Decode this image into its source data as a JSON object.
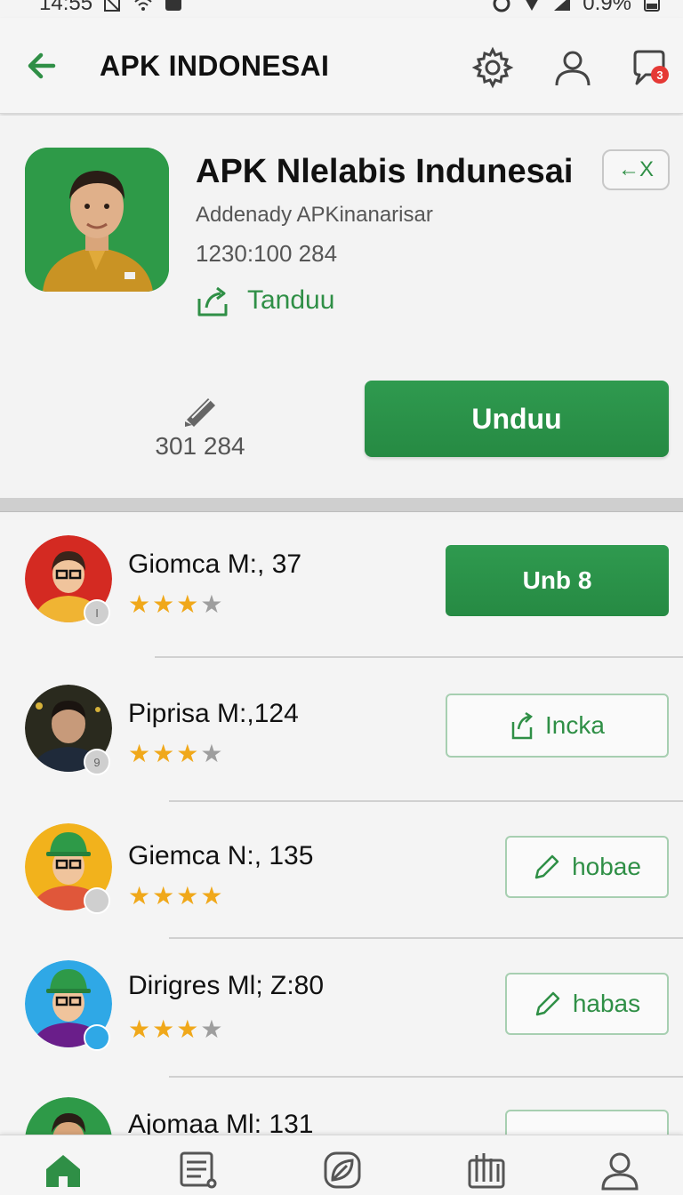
{
  "status_bar": {
    "time": "14:55",
    "battery": "0.9%"
  },
  "header": {
    "title": "APK INDONESAI",
    "notification_count": "3"
  },
  "app": {
    "name": "APK Nlelabis Indunesai",
    "developer": "Addenady APKinanarisar",
    "number": "1230:100 284",
    "share_label": "Tanduu",
    "exit_label": "←X",
    "download_count": "301 284",
    "primary_button": "Unduu"
  },
  "list_items": [
    {
      "name": "Giomca M:, 37",
      "rating": 3,
      "button": "Unb 8",
      "button_style": "filled",
      "badge": "I"
    },
    {
      "name": "Piprisa M:,124",
      "rating": 3,
      "button": "Incka",
      "button_style": "outline",
      "badge": "9"
    },
    {
      "name": "Giemca N:, 135",
      "rating": 4,
      "button": "hobae",
      "button_style": "outline",
      "badge": ""
    },
    {
      "name": "Dirigres Ml; Z:80",
      "rating": 3,
      "button": "habas",
      "button_style": "outline",
      "badge": ""
    },
    {
      "name": "Ajomaa Ml: 131",
      "rating": 0,
      "button": "",
      "button_style": "outline",
      "badge": ""
    }
  ],
  "icons": {
    "back": "arrow-left-icon",
    "settings": "gear-icon",
    "account": "user-icon",
    "messages": "chat-icon",
    "share": "share-icon",
    "downloads": "pen-icon",
    "nav": [
      "home-icon",
      "document-icon",
      "leaf-icon",
      "chart-icon",
      "profile-icon"
    ]
  },
  "colors": {
    "accent": "#2f9a4f",
    "star": "#f0a81a",
    "badge": "#e53935"
  }
}
